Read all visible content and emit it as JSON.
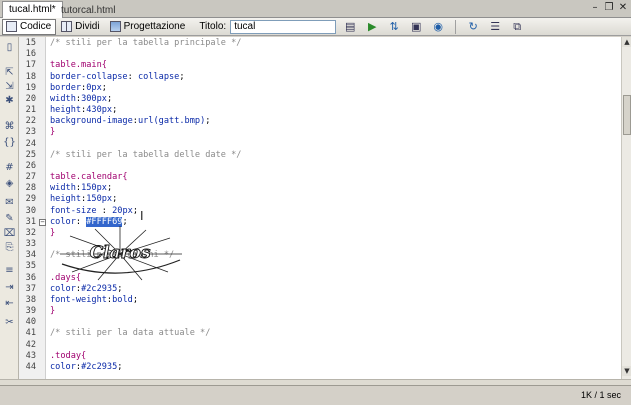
{
  "tabs": [
    {
      "label": "tucal.html*",
      "active": true
    },
    {
      "label": "tutorcal.html",
      "active": false
    }
  ],
  "window_controls": [
    "–",
    "❐",
    "✕"
  ],
  "toolbar": {
    "code_label": "Codice",
    "split_label": "Dividi",
    "design_label": "Progettazione",
    "title_label": "Titolo:",
    "title_value": "tucal"
  },
  "code_lines": [
    {
      "n": "15",
      "parts": [
        [
          "/* stili per la tabella principale */",
          "c-comment"
        ]
      ]
    },
    {
      "n": "16",
      "parts": []
    },
    {
      "n": "17",
      "parts": [
        [
          "table.main{",
          "c-sel"
        ]
      ]
    },
    {
      "n": "18",
      "parts": [
        [
          "border-collapse",
          "c-prop"
        ],
        [
          ": ",
          ""
        ],
        [
          "collapse",
          "c-val"
        ],
        [
          ";",
          ""
        ]
      ]
    },
    {
      "n": "19",
      "parts": [
        [
          "border",
          "c-prop"
        ],
        [
          ":",
          ""
        ],
        [
          "0px",
          "c-val"
        ],
        [
          ";",
          ""
        ]
      ]
    },
    {
      "n": "20",
      "parts": [
        [
          "width",
          "c-prop"
        ],
        [
          ":",
          ""
        ],
        [
          "300px",
          "c-val"
        ],
        [
          ";",
          ""
        ]
      ]
    },
    {
      "n": "21",
      "parts": [
        [
          "height",
          "c-prop"
        ],
        [
          ":",
          ""
        ],
        [
          "430px",
          "c-val"
        ],
        [
          ";",
          ""
        ]
      ]
    },
    {
      "n": "22",
      "parts": [
        [
          "background-image",
          "c-prop"
        ],
        [
          ":",
          ""
        ],
        [
          "url(gatt.bmp)",
          "c-val"
        ],
        [
          ";",
          ""
        ]
      ]
    },
    {
      "n": "23",
      "parts": [
        [
          "}",
          "c-brace"
        ]
      ]
    },
    {
      "n": "24",
      "parts": []
    },
    {
      "n": "25",
      "parts": [
        [
          "/* stili per la tabella delle date */",
          "c-comment"
        ]
      ]
    },
    {
      "n": "26",
      "parts": []
    },
    {
      "n": "27",
      "parts": [
        [
          "table.calendar{",
          "c-sel"
        ]
      ]
    },
    {
      "n": "28",
      "parts": [
        [
          "width",
          "c-prop"
        ],
        [
          ":",
          ""
        ],
        [
          "150px",
          "c-val"
        ],
        [
          ";",
          ""
        ]
      ]
    },
    {
      "n": "29",
      "parts": [
        [
          "height",
          "c-prop"
        ],
        [
          ":",
          ""
        ],
        [
          "150px",
          "c-val"
        ],
        [
          ";",
          ""
        ]
      ]
    },
    {
      "n": "30",
      "parts": [
        [
          "font-size",
          "c-prop"
        ],
        [
          " : ",
          ""
        ],
        [
          "20px",
          "c-val"
        ],
        [
          ";",
          ""
        ]
      ]
    },
    {
      "n": "31",
      "fold": true,
      "parts": [
        [
          "color",
          "c-prop"
        ],
        [
          ": ",
          ""
        ],
        [
          "#FFFF69",
          "c-hl"
        ],
        [
          ";",
          ""
        ]
      ]
    },
    {
      "n": "32",
      "parts": [
        [
          "}",
          "c-brace"
        ]
      ]
    },
    {
      "n": "33",
      "parts": []
    },
    {
      "n": "34",
      "parts": [
        [
          "/* stili per i giorni */",
          "c-comment"
        ]
      ]
    },
    {
      "n": "35",
      "parts": []
    },
    {
      "n": "36",
      "parts": [
        [
          ".days{",
          "c-sel"
        ]
      ]
    },
    {
      "n": "37",
      "parts": [
        [
          "color",
          "c-prop"
        ],
        [
          ":",
          ""
        ],
        [
          "#2c2935",
          "c-val"
        ],
        [
          ";",
          ""
        ]
      ]
    },
    {
      "n": "38",
      "parts": [
        [
          "font-weight",
          "c-prop"
        ],
        [
          ":",
          ""
        ],
        [
          "bold",
          "c-val"
        ],
        [
          ";",
          ""
        ]
      ]
    },
    {
      "n": "39",
      "parts": [
        [
          "}",
          "c-brace"
        ]
      ]
    },
    {
      "n": "40",
      "parts": []
    },
    {
      "n": "41",
      "parts": [
        [
          "/* stili per la data attuale */",
          "c-comment"
        ]
      ]
    },
    {
      "n": "42",
      "parts": []
    },
    {
      "n": "43",
      "parts": [
        [
          ".today{",
          "c-sel"
        ]
      ]
    },
    {
      "n": "44",
      "parts": [
        [
          "color",
          "c-prop"
        ],
        [
          ":",
          ""
        ],
        [
          "#2c2935",
          "c-val"
        ],
        [
          ";",
          ""
        ]
      ]
    }
  ],
  "watermark_text": "Claros",
  "status": {
    "text": "1K / 1 sec"
  }
}
